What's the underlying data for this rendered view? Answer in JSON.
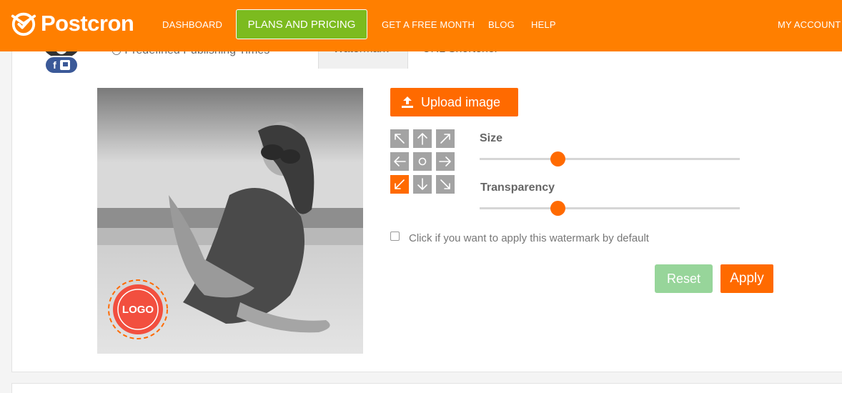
{
  "colors": {
    "brand_orange": "#ff7f00",
    "accent_orange": "#ff6a00",
    "plans_green": "#7cbb1f",
    "reset_green": "#97d59a",
    "position_inactive": "#a3a3a3"
  },
  "brand": {
    "name": "Postcron",
    "icon": "postcron-logo-icon"
  },
  "nav": {
    "dashboard": "DASHBOARD",
    "plans": "PLANS AND PRICING",
    "free_month": "GET A FREE MONTH",
    "blog": "BLOG",
    "help": "HELP",
    "account": "MY ACCOUNT"
  },
  "tabs": [
    {
      "label": "Predefined Publishing Times",
      "active": false
    },
    {
      "label": "Watermark",
      "active": true
    },
    {
      "label": "URL Shortener",
      "active": false
    }
  ],
  "account_badges": {
    "facebook": "f",
    "page_icon": "flag-icon"
  },
  "preview": {
    "watermark_text": "LOGO",
    "watermark_position": "bottom-left"
  },
  "upload": {
    "label": "Upload image",
    "icon": "upload-icon"
  },
  "position_grid": [
    {
      "icon": "arrow-up-left-icon",
      "active": false
    },
    {
      "icon": "arrow-up-icon",
      "active": false
    },
    {
      "icon": "arrow-up-right-icon",
      "active": false
    },
    {
      "icon": "arrow-left-icon",
      "active": false
    },
    {
      "icon": "center-circle-icon",
      "active": false
    },
    {
      "icon": "arrow-right-icon",
      "active": false
    },
    {
      "icon": "arrow-down-left-icon",
      "active": true
    },
    {
      "icon": "arrow-down-icon",
      "active": false
    },
    {
      "icon": "arrow-down-right-icon",
      "active": false
    }
  ],
  "size": {
    "label": "Size",
    "value_fraction": 0.3
  },
  "transparency": {
    "label": "Transparency",
    "value_fraction": 0.3
  },
  "default_option": {
    "label": "Click if you want to apply this watermark by default",
    "checked": false
  },
  "buttons": {
    "reset": "Reset",
    "apply": "Apply"
  }
}
